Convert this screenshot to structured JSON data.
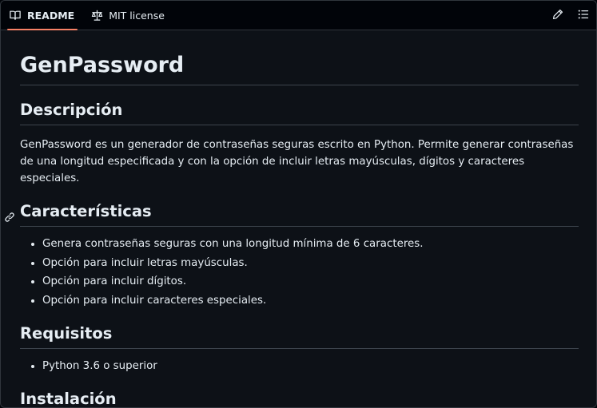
{
  "tabs": {
    "readme": "README",
    "license": "MIT license"
  },
  "readme": {
    "title": "GenPassword",
    "sections": [
      {
        "heading": "Descripción",
        "paragraph": "GenPassword es un generador de contraseñas seguras escrito en Python. Permite generar contraseñas de una longitud especificada y con la opción de incluir letras mayúsculas, dígitos y caracteres especiales."
      },
      {
        "heading": "Características",
        "items": [
          "Genera contraseñas seguras con una longitud mínima de 6 caracteres.",
          "Opción para incluir letras mayúsculas.",
          "Opción para incluir dígitos.",
          "Opción para incluir caracteres especiales."
        ]
      },
      {
        "heading": "Requisitos",
        "items": [
          "Python 3.6 o superior"
        ]
      },
      {
        "heading": "Instalación"
      }
    ]
  },
  "icons": {
    "readme_tab": "book-icon",
    "license_tab": "scale-icon",
    "edit": "pencil-icon",
    "outline": "list-unordered-icon",
    "anchor": "link-icon"
  },
  "colors": {
    "background": "#0d1117",
    "tab_bar": "#010409",
    "active_tab_underline": "#f78166",
    "text": "#e6edf3",
    "border": "#30363d"
  }
}
